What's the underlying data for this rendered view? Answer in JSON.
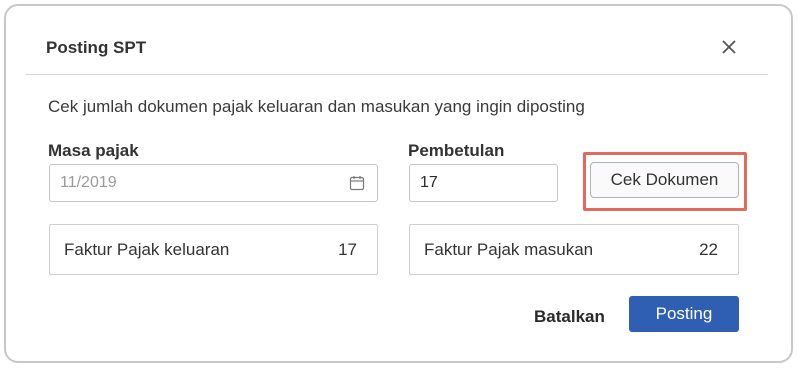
{
  "dialog": {
    "title": "Posting SPT",
    "close_icon": "close-icon",
    "instruction": "Cek jumlah dokumen pajak keluaran dan masukan yang ingin diposting"
  },
  "form": {
    "tax_period_label": "Masa pajak",
    "tax_period_value": "11/2019",
    "calendar_icon": "calendar-icon",
    "correction_label": "Pembetulan",
    "correction_value": "17",
    "check_button_label": "Cek Dokumen"
  },
  "summary": {
    "output_label": "Faktur Pajak keluaran",
    "output_count": "17",
    "input_label": "Faktur Pajak masukan",
    "input_count": "22"
  },
  "actions": {
    "cancel_label": "Batalkan",
    "post_label": "Posting"
  },
  "colors": {
    "primary": "#2f5fb3",
    "highlight": "#e3695a"
  }
}
